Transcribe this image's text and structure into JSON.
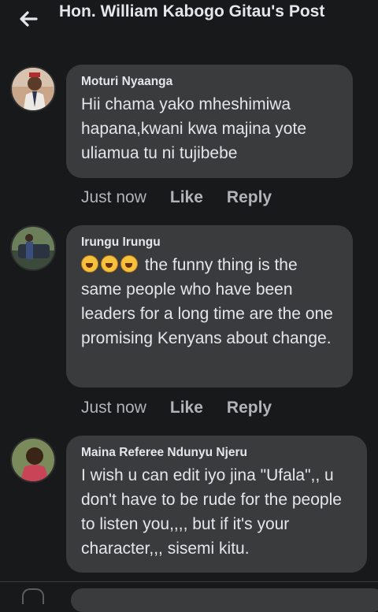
{
  "header": {
    "title": "Hon. William Kabogo Gitau's Post",
    "back_icon": "arrow-left-icon"
  },
  "comments": [
    {
      "name": "Moturi Nyaanga",
      "text": "Hii chama yako mheshimiwa hapana,kwani kwa majina yote uliamua tu ni tujibebe",
      "time": "Just now",
      "like": "Like",
      "reply": "Reply"
    },
    {
      "name": "Irungu Irungu",
      "emoji": "rolling-on-floor-laughing-icon",
      "text": "the funny thing is the same people who have been leaders for a long time are the one promising Kenyans about change.",
      "time": "Just now",
      "like": "Like",
      "reply": "Reply"
    },
    {
      "name": "Maina Referee Ndunyu Njeru",
      "text": "I wish u can edit iyo jina \"Ufala\",, u don't have to be rude for the people to listen you,,,, but if it's your character,,, sisemi kitu."
    }
  ],
  "colors": {
    "background": "#18191a",
    "bubble": "#3a3b3c",
    "text": "#e4e6eb",
    "muted": "#b0b3b8"
  }
}
